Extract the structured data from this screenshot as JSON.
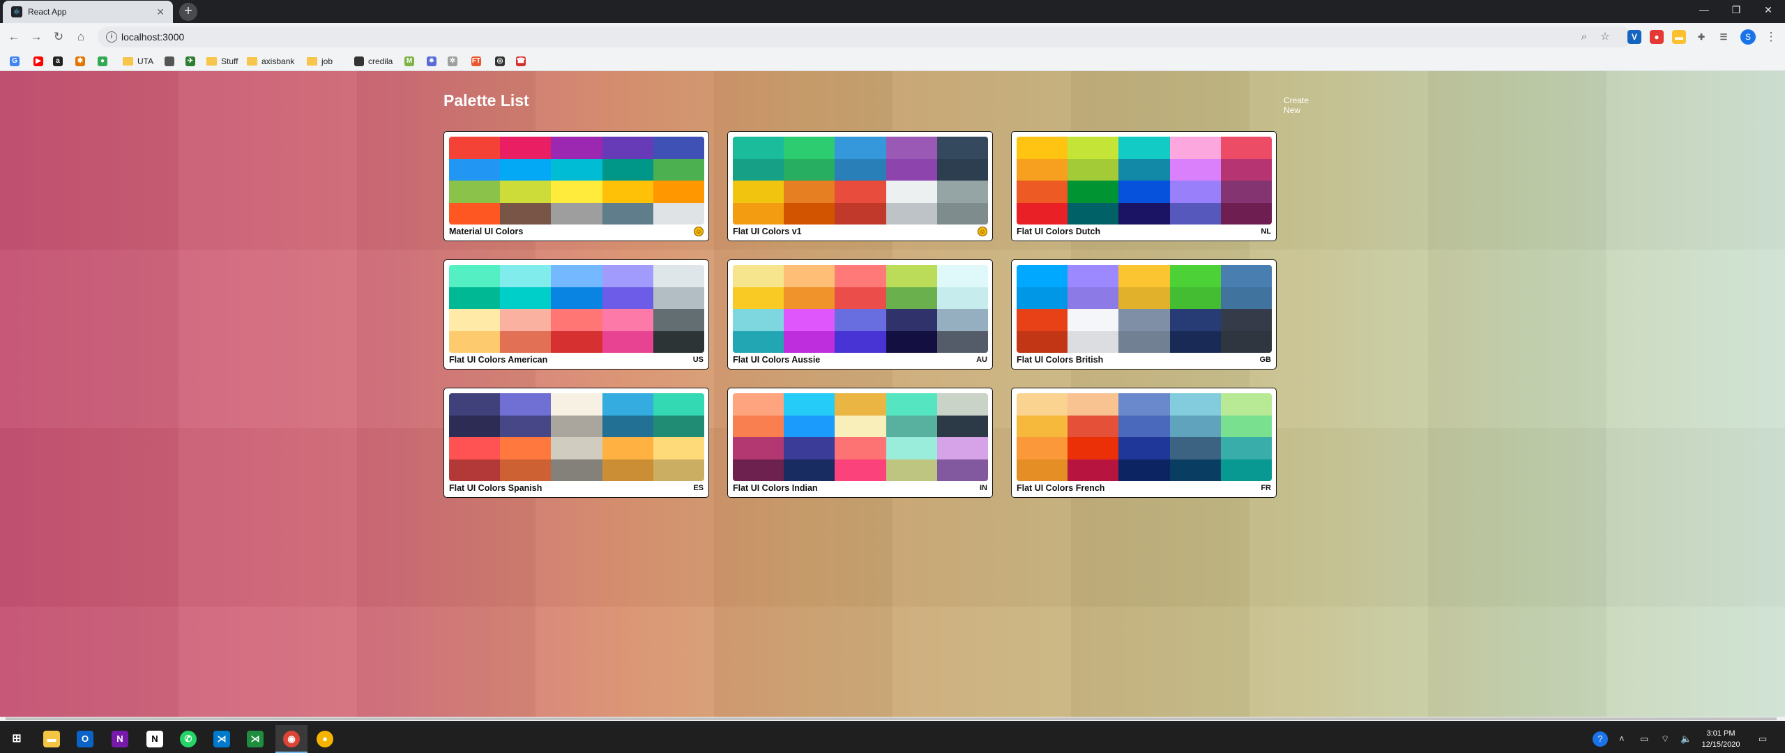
{
  "browser": {
    "tab_title": "React App",
    "url": "localhost:3000",
    "profile_initial": "S",
    "bookmarks": [
      {
        "label": "",
        "icon": "google-icon",
        "color": "#4285f4",
        "glyph": "G"
      },
      {
        "label": "",
        "icon": "youtube-icon",
        "color": "#ff0000",
        "glyph": "▶"
      },
      {
        "label": "",
        "icon": "amazon-icon",
        "color": "#222222",
        "glyph": "a"
      },
      {
        "label": "",
        "icon": "pinwheel-icon",
        "color": "#e37400",
        "glyph": "✱"
      },
      {
        "label": "",
        "icon": "maps-pin-icon",
        "color": "#34a853",
        "glyph": "●"
      },
      {
        "label": "UTA",
        "icon": "folder-icon"
      },
      {
        "label": "",
        "icon": "apple-icon",
        "color": "#555555",
        "glyph": ""
      },
      {
        "label": "",
        "icon": "bird-icon",
        "color": "#2e7d32",
        "glyph": "✈"
      },
      {
        "label": "Stuff",
        "icon": "folder-icon"
      },
      {
        "label": "axisbank",
        "icon": "folder-icon"
      },
      {
        "label": "job",
        "icon": "folder-icon"
      },
      {
        "label": "credila",
        "icon": "globe-icon"
      },
      {
        "label": "",
        "icon": "m-icon",
        "color": "#7cb342",
        "glyph": "M"
      },
      {
        "label": "",
        "icon": "react-icon",
        "color": "#5b6bd6",
        "glyph": "✷"
      },
      {
        "label": "",
        "icon": "settings-icon",
        "color": "#9e9e9e",
        "glyph": "✲"
      },
      {
        "label": "",
        "icon": "ft-icon",
        "color": "#e8552f",
        "glyph": "FT"
      },
      {
        "label": "",
        "icon": "globe-icon",
        "color": "#333333",
        "glyph": "◎"
      },
      {
        "label": "",
        "icon": "dialog-icon",
        "color": "#d32f2f",
        "glyph": "☎"
      }
    ]
  },
  "page": {
    "title": "Palette List",
    "create_new": "Create New",
    "palettes": [
      {
        "name": "Material UI Colors",
        "emoji": "emoji-badge",
        "colors": [
          "#f44336",
          "#e91e63",
          "#9c27b0",
          "#673ab7",
          "#3f51b5",
          "#2196f3",
          "#03a9f4",
          "#00bcd4",
          "#009688",
          "#4caf50",
          "#8bc34a",
          "#cddc39",
          "#ffeb3b",
          "#ffc107",
          "#ff9800",
          "#ff5722",
          "#795548",
          "#9e9e9e",
          "#607d8b",
          "#dfe3e6"
        ]
      },
      {
        "name": "Flat UI Colors v1",
        "emoji": "emoji-badge",
        "colors": [
          "#1abc9c",
          "#2ecc71",
          "#3498db",
          "#9b59b6",
          "#34495e",
          "#16a085",
          "#27ae60",
          "#2980b9",
          "#8e44ad",
          "#2c3e50",
          "#f1c40f",
          "#e67e22",
          "#e74c3c",
          "#ecf0f1",
          "#95a5a6",
          "#f39c12",
          "#d35400",
          "#c0392b",
          "#bdc3c7",
          "#7f8c8d"
        ]
      },
      {
        "name": "Flat UI Colors Dutch",
        "emoji": "NL",
        "colors": [
          "#ffc312",
          "#c4e538",
          "#12cbc4",
          "#fda7df",
          "#ed4c67",
          "#f79f1f",
          "#a3cb38",
          "#1289a7",
          "#d980fa",
          "#b53471",
          "#ee5a24",
          "#009432",
          "#0652dd",
          "#9980fa",
          "#833471",
          "#ea2027",
          "#006266",
          "#1b1464",
          "#5758bb",
          "#6f1e51"
        ]
      },
      {
        "name": "Flat UI Colors American",
        "emoji": "US",
        "colors": [
          "#55efc4",
          "#81ecec",
          "#74b9ff",
          "#a29bfe",
          "#dfe6e9",
          "#00b894",
          "#00cec9",
          "#0984e3",
          "#6c5ce7",
          "#b2bec3",
          "#ffeaa7",
          "#fab1a0",
          "#ff7675",
          "#fd79a8",
          "#636e72",
          "#fdcb6e",
          "#e17055",
          "#d63031",
          "#e84393",
          "#2d3436"
        ]
      },
      {
        "name": "Flat UI Colors Aussie",
        "emoji": "AU",
        "colors": [
          "#f6e58d",
          "#ffbe76",
          "#ff7979",
          "#badc58",
          "#dff9fb",
          "#f9ca24",
          "#f0932b",
          "#eb4d4b",
          "#6ab04c",
          "#c7ecee",
          "#7ed6df",
          "#e056fd",
          "#686de0",
          "#30336b",
          "#95afc0",
          "#22a6b3",
          "#be2edd",
          "#4834d4",
          "#130f40",
          "#535c68"
        ]
      },
      {
        "name": "Flat UI Colors British",
        "emoji": "GB",
        "colors": [
          "#00a8ff",
          "#9c88ff",
          "#fbc531",
          "#4cd137",
          "#487eb0",
          "#0097e6",
          "#8c7ae6",
          "#e1b12c",
          "#44bd32",
          "#40739e",
          "#e84118",
          "#f5f6fa",
          "#7f8fa6",
          "#273c75",
          "#353b48",
          "#c23616",
          "#dcdde1",
          "#718093",
          "#192a56",
          "#2f3640"
        ]
      },
      {
        "name": "Flat UI Colors Spanish",
        "emoji": "ES",
        "colors": [
          "#40407a",
          "#706fd3",
          "#f7f1e3",
          "#34ace0",
          "#33d9b2",
          "#2c2c54",
          "#474787",
          "#aaa69d",
          "#227093",
          "#218c74",
          "#ff5252",
          "#ff793f",
          "#d1ccc0",
          "#ffb142",
          "#ffda79",
          "#b33939",
          "#cd6133",
          "#84817a",
          "#cc8e35",
          "#ccae62"
        ]
      },
      {
        "name": "Flat UI Colors Indian",
        "emoji": "IN",
        "colors": [
          "#fea47f",
          "#25ccf7",
          "#eab543",
          "#55e6c1",
          "#cad3c8",
          "#f97f51",
          "#1b9cfc",
          "#f8efba",
          "#58b19f",
          "#2c3a47",
          "#b33771",
          "#3b3b98",
          "#fd7272",
          "#9aecdb",
          "#d6a2e8",
          "#6d214f",
          "#182c61",
          "#fc427b",
          "#bdc581",
          "#82589f"
        ]
      },
      {
        "name": "Flat UI Colors French",
        "emoji": "FR",
        "colors": [
          "#fad390",
          "#f8c291",
          "#6a89cc",
          "#82ccdd",
          "#b8e994",
          "#f6b93b",
          "#e55039",
          "#4a69bd",
          "#60a3bc",
          "#78e08f",
          "#fa983a",
          "#eb2f06",
          "#1e3799",
          "#3c6382",
          "#38ada9",
          "#e58e26",
          "#b71540",
          "#0c2461",
          "#0a3d62",
          "#079992"
        ]
      }
    ]
  },
  "taskbar": {
    "time": "3:01 PM",
    "date": "12/15/2020"
  }
}
